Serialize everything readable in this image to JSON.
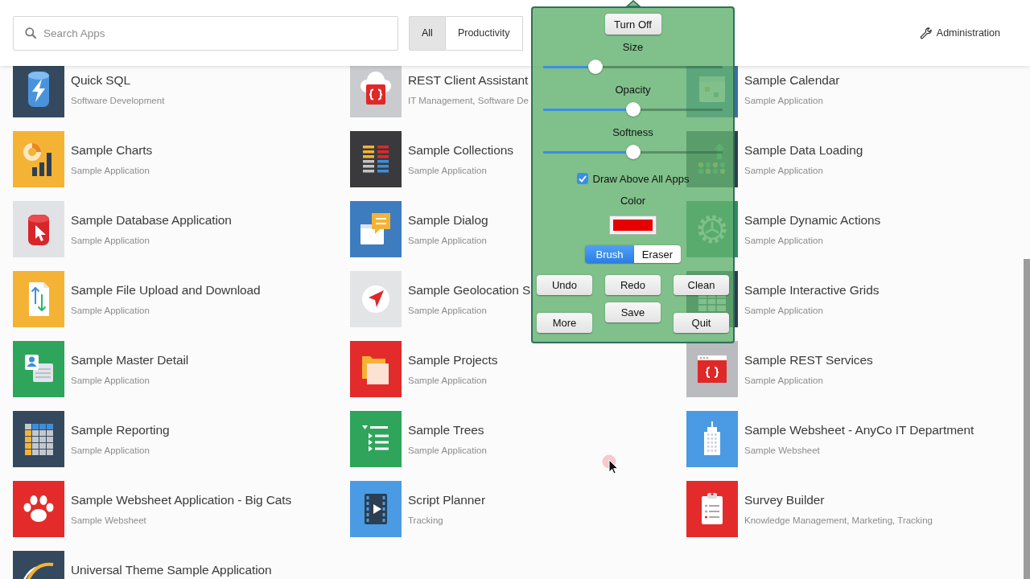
{
  "header": {
    "search": {
      "placeholder": "Search Apps"
    },
    "filters": [
      {
        "label": "All",
        "selected": true
      },
      {
        "label": "Productivity",
        "selected": false
      }
    ],
    "admin_link": "Administration"
  },
  "apps": [
    {
      "title": "Quick SQL",
      "category": "Software Development"
    },
    {
      "title": "REST Client Assistant",
      "category": "IT Management, Software De"
    },
    {
      "title": "Sample Calendar",
      "category": "Sample Application"
    },
    {
      "title": "Sample Charts",
      "category": "Sample Application"
    },
    {
      "title": "Sample Collections",
      "category": "Sample Application"
    },
    {
      "title": "Sample Data Loading",
      "category": "Sample Application"
    },
    {
      "title": "Sample Database Application",
      "category": "Sample Application"
    },
    {
      "title": "Sample Dialog",
      "category": "Sample Application"
    },
    {
      "title": "Sample Dynamic Actions",
      "category": "Sample Application"
    },
    {
      "title": "Sample File Upload and Download",
      "category": "Sample Application"
    },
    {
      "title": "Sample Geolocation S",
      "category": "Sample Application"
    },
    {
      "title": "Sample Interactive Grids",
      "category": "Sample Application"
    },
    {
      "title": "Sample Master Detail",
      "category": "Sample Application"
    },
    {
      "title": "Sample Projects",
      "category": "Sample Application"
    },
    {
      "title": "Sample REST Services",
      "category": "Sample Application"
    },
    {
      "title": "Sample Reporting",
      "category": "Sample Application"
    },
    {
      "title": "Sample Trees",
      "category": "Sample Application"
    },
    {
      "title": "Sample Websheet - AnyCo IT Department",
      "category": "Sample Websheet"
    },
    {
      "title": "Sample Websheet Application - Big Cats",
      "category": "Sample Websheet"
    },
    {
      "title": "Script Planner",
      "category": "Tracking"
    },
    {
      "title": "Survey Builder",
      "category": "Knowledge Management, Marketing, Tracking"
    },
    {
      "title": "Universal Theme Sample Application"
    }
  ],
  "drawing_panel": {
    "power_button": "Turn Off",
    "sliders": [
      {
        "label": "Size",
        "level": 0.29
      },
      {
        "label": "Opacity",
        "level": 0.5
      },
      {
        "label": "Softness",
        "level": 0.5
      }
    ],
    "draw_above": {
      "label": "Draw Above All Apps",
      "checked": true
    },
    "color_picker": {
      "label": "Color",
      "color": "#e60000"
    },
    "tools": [
      {
        "label": "Brush",
        "selected": true
      },
      {
        "label": "Eraser",
        "selected": false
      }
    ],
    "actions": [
      "Undo",
      "Redo",
      "Clean",
      "More",
      "Save",
      "Quit"
    ]
  }
}
